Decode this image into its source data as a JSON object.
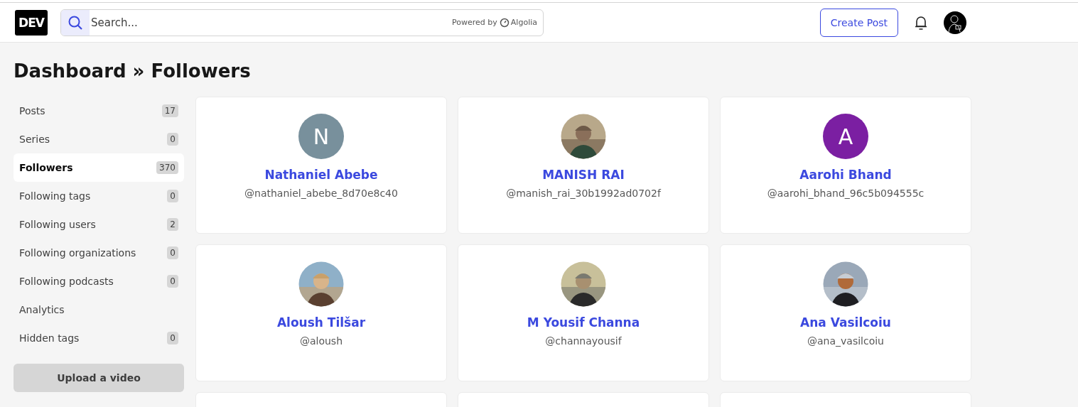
{
  "header": {
    "logo": "DEV",
    "search": {
      "placeholder": "Search...",
      "powered_by": "Powered by",
      "provider": "Algolia"
    },
    "create_button": "Create Post"
  },
  "page_title": "Dashboard » Followers",
  "sidebar": {
    "items": [
      {
        "label": "Posts",
        "count": "17",
        "selected": false
      },
      {
        "label": "Series",
        "count": "0",
        "selected": false
      },
      {
        "label": "Followers",
        "count": "370",
        "selected": true
      },
      {
        "label": "Following tags",
        "count": "0",
        "selected": false
      },
      {
        "label": "Following users",
        "count": "2",
        "selected": false
      },
      {
        "label": "Following organizations",
        "count": "0",
        "selected": false
      },
      {
        "label": "Following podcasts",
        "count": "0",
        "selected": false
      },
      {
        "label": "Analytics",
        "selected": false
      },
      {
        "label": "Hidden tags",
        "count": "0",
        "selected": false
      }
    ],
    "upload_button": "Upload a video"
  },
  "followers": [
    {
      "kind": "user",
      "name": "Nathaniel Abebe",
      "handle": "@nathaniel_abebe_8d70e8c40",
      "avatar": {
        "kind": "letter",
        "letter": "N",
        "color": "#78909c"
      }
    },
    {
      "kind": "user",
      "name": "MANISH RAI",
      "handle": "@manish_rai_30b1992ad0702f"
    },
    {
      "kind": "user",
      "name": "Aarohi Bhand",
      "handle": "@aarohi_bhand_96c5b094555c",
      "avatar": {
        "kind": "letter",
        "letter": "A",
        "color": "#7b1fa2"
      }
    },
    {
      "kind": "user",
      "name": "Aloush Tilšar",
      "handle": "@aloush"
    },
    {
      "kind": "user",
      "name": "M Yousif Channa",
      "handle": "@channayousif"
    },
    {
      "kind": "user",
      "name": "Ana Vasilcoiu",
      "handle": "@ana_vasilcoiu"
    },
    {
      "kind": "cut_off"
    },
    {
      "kind": "cut_off"
    },
    {
      "kind": "cut_off"
    }
  ]
}
